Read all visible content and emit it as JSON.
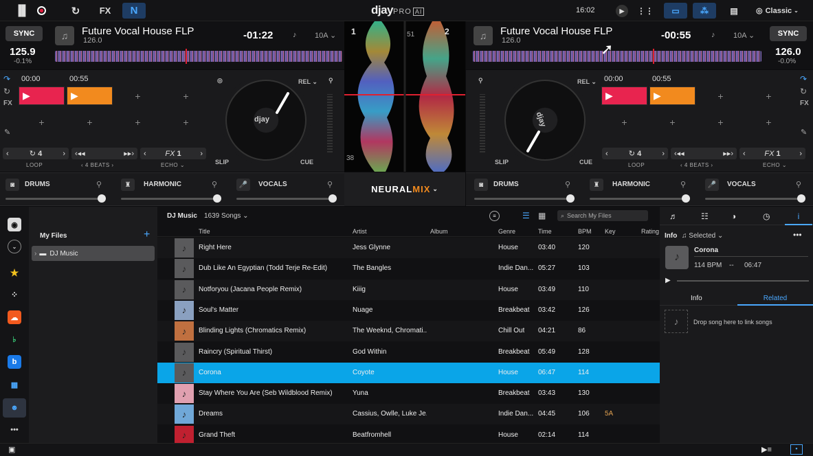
{
  "app": {
    "logo": "djay",
    "logo_suffix": "PRO",
    "logo_badge": "AI",
    "clock": "16:02",
    "skin": "Classic"
  },
  "topbar": {
    "fx_label": "FX",
    "neural_label": "N"
  },
  "deck_left": {
    "number": "1",
    "sync": "SYNC",
    "bpm": "125.9",
    "pitch": "-0.1%",
    "title": "Future Vocal House FLP",
    "subtitle": "126.0",
    "time": "-01:22",
    "key": "10A",
    "cues": [
      "00:00",
      "00:55"
    ],
    "loop_value": "4",
    "loop_label": "LOOP",
    "beats_label": "4 BEATS",
    "fx_value": "1",
    "echo_label": "ECHO",
    "rel_label": "REL",
    "slip_label": "SLIP",
    "cue_label": "CUE",
    "platter_label": "djay",
    "side_fx": "FX"
  },
  "deck_right": {
    "number": "2",
    "sync": "SYNC",
    "bpm": "126.0",
    "pitch": "-0.0%",
    "title": "Future Vocal House FLP",
    "subtitle": "126.0",
    "time": "-00:55",
    "key": "10A",
    "cues": [
      "00:00",
      "00:55"
    ],
    "loop_value": "4",
    "loop_label": "LOOP",
    "beats_label": "4 BEATS",
    "fx_value": "1",
    "echo_label": "ECHO",
    "rel_label": "REL",
    "slip_label": "SLIP",
    "cue_label": "CUE",
    "platter_label": "djay",
    "side_fx": "FX"
  },
  "center": {
    "left_beat": "51",
    "left_beat2": "38",
    "neural_a": "NEURAL",
    "neural_b": "MIX"
  },
  "stems": {
    "drums": "DRUMS",
    "harmonic": "HARMONIC",
    "vocals": "VOCALS"
  },
  "library": {
    "source": "DJ Music",
    "count": "1639 Songs",
    "search_placeholder": "Search My Files",
    "my_files": "My Files",
    "folder": "DJ Music",
    "columns": [
      "Title",
      "Artist",
      "Album",
      "Genre",
      "Time",
      "BPM",
      "Key",
      "Rating"
    ],
    "tracks": [
      {
        "title": "Right Here",
        "artist": "Jess Glynne",
        "album": "",
        "genre": "House",
        "time": "03:40",
        "bpm": "120",
        "key": ""
      },
      {
        "title": "Dub Like An Egyptian (Todd Terje Re-Edit)",
        "artist": "The Bangles",
        "album": "",
        "genre": "Indie Dan...",
        "time": "05:27",
        "bpm": "103",
        "key": ""
      },
      {
        "title": "Notforyou (Jacana People Remix)",
        "artist": "Kiiig",
        "album": "",
        "genre": "House",
        "time": "03:49",
        "bpm": "110",
        "key": ""
      },
      {
        "title": "Soul's Matter",
        "artist": "Nuage",
        "album": "",
        "genre": "Breakbeat",
        "time": "03:42",
        "bpm": "126",
        "key": ""
      },
      {
        "title": "Blinding Lights (Chromatics Remix)",
        "artist": "The Weeknd, Chromati...",
        "album": "",
        "genre": "Chill Out",
        "time": "04:21",
        "bpm": "86",
        "key": ""
      },
      {
        "title": "Raincry (Spiritual Thirst)",
        "artist": "God Within",
        "album": "",
        "genre": "Breakbeat",
        "time": "05:49",
        "bpm": "128",
        "key": ""
      },
      {
        "title": "Corona",
        "artist": "Coyote",
        "album": "",
        "genre": "House",
        "time": "06:47",
        "bpm": "114",
        "key": ""
      },
      {
        "title": "Stay Where You Are (Seb Wildblood Remix)",
        "artist": "Yuna",
        "album": "",
        "genre": "Breakbeat",
        "time": "03:43",
        "bpm": "130",
        "key": ""
      },
      {
        "title": "Dreams",
        "artist": "Cassius, Owlle, Luke Je...",
        "album": "",
        "genre": "Indie Dan...",
        "time": "04:45",
        "bpm": "106",
        "key": "5A"
      },
      {
        "title": "Grand Theft",
        "artist": "Beatfromhell",
        "album": "",
        "genre": "House",
        "time": "02:14",
        "bpm": "114",
        "key": ""
      }
    ],
    "selected_index": 6
  },
  "info": {
    "label": "Info",
    "selected": "Selected",
    "title": "Corona",
    "bpm": "114 BPM",
    "sep": "--",
    "time": "06:47",
    "tab_info": "Info",
    "tab_related": "Related",
    "drop_hint": "Drop song here to link songs"
  },
  "colors": {
    "accent": "#0aa5e8",
    "cue_pink": "#e8244f",
    "cue_orange": "#f28a1e",
    "key_orange": "#e0a050"
  }
}
